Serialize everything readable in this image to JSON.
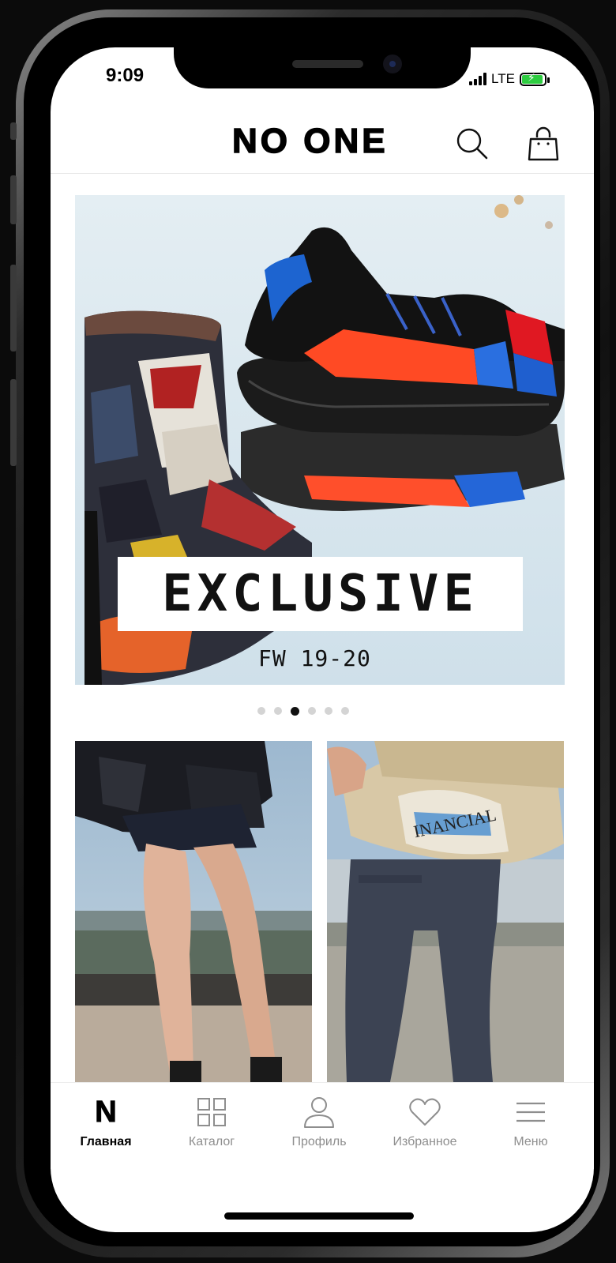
{
  "status_bar": {
    "time": "9:09",
    "network": "LTE"
  },
  "header": {
    "brand": "NO ONE"
  },
  "hero": {
    "title": "EXCLUSIVE",
    "subtitle": "FW 19-20"
  },
  "carousel": {
    "count": 6,
    "active_index": 2
  },
  "tiles": [
    {
      "name": "women-look"
    },
    {
      "name": "men-look",
      "newspaper_text": "INANCIAL"
    }
  ],
  "tabbar": {
    "items": [
      {
        "label": "Главная",
        "icon": "n-logo-icon",
        "active": true
      },
      {
        "label": "Каталог",
        "icon": "grid-icon",
        "active": false
      },
      {
        "label": "Профиль",
        "icon": "person-icon",
        "active": false
      },
      {
        "label": "Избранное",
        "icon": "heart-icon",
        "active": false
      },
      {
        "label": "Меню",
        "icon": "menu-icon",
        "active": false
      }
    ]
  },
  "colors": {
    "text": "#000000",
    "inactive_tab": "#8e8e8e",
    "dot_active": "#111111",
    "dot_inactive": "#d4d4d4"
  }
}
